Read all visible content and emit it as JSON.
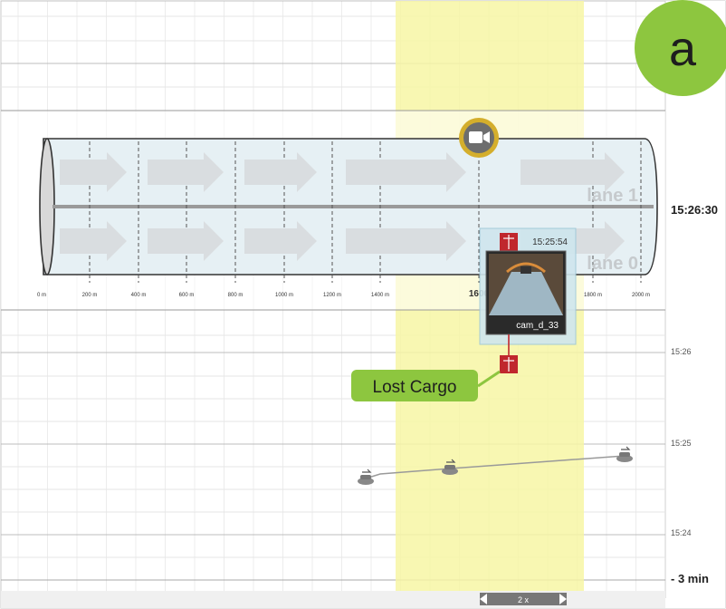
{
  "panel_label": "a",
  "tunnel": {
    "lanes": [
      "lane 1",
      "lane 0"
    ],
    "distance_ticks": [
      "0 m",
      "200 m",
      "400 m",
      "600 m",
      "800 m",
      "1000 m",
      "1200 m",
      "1400 m",
      "1600",
      "1800 m",
      "2000 m"
    ]
  },
  "time_axis": {
    "current_time": "15:26:30",
    "ticks": [
      "15:26",
      "15:25",
      "15:24"
    ],
    "range_label": "- 3 min"
  },
  "camera_popup": {
    "timestamp": "15:25:54",
    "camera_id": "cam_d_33"
  },
  "event": {
    "label": "Lost Cargo"
  },
  "zoom": {
    "label": "2 x"
  },
  "colors": {
    "highlight": "#f7f6a4",
    "panel_badge": "#8dc63f",
    "event_label": "#8dc63f",
    "cargo_icon": "#c0272d",
    "camera_ring": "#d4ae2c"
  },
  "icons": [
    "camera-icon",
    "cargo-box-icon",
    "vehicle-icon",
    "chevron-left-icon",
    "chevron-right-icon"
  ]
}
